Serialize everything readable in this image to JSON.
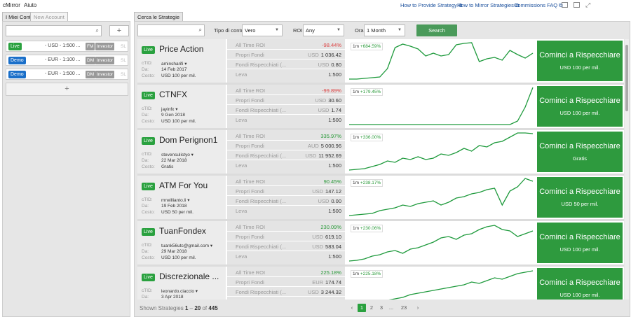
{
  "menu": {
    "app": "cMirror",
    "help": "Aiuto"
  },
  "toplinks": [
    {
      "label": "How to Provide Strategy"
    },
    {
      "label": "How to Mirror Strategies"
    },
    {
      "label": "Commissions FAQ"
    }
  ],
  "left": {
    "tabs": [
      "I Miei Conti",
      "New Account"
    ],
    "plus": "+",
    "accounts": [
      {
        "type": "Live",
        "text": "- USD - 1:500 ...",
        "chips": [
          "FM",
          "Investor",
          "SL"
        ]
      },
      {
        "type": "Demo",
        "text": "- EUR - 1:100 ...",
        "chips": [
          "DM",
          "Investor",
          "SL"
        ]
      },
      {
        "type": "Demo",
        "text": "- EUR - 1:500 ...",
        "chips": [
          "DM",
          "Investor",
          "SL"
        ]
      }
    ],
    "add_label": "+"
  },
  "right": {
    "tab": "Cerca le Strategie",
    "filters": {
      "account_type_label": "Tipo di conto",
      "account_type": "Vero",
      "roi_label": "ROI",
      "roi": "Any",
      "time_label": "Ora",
      "time": "1 Month",
      "search_button": "Search"
    },
    "stat_labels": [
      "All Time ROI",
      "Propri Fondi",
      "Fondi Rispecchiati (...",
      "Leva"
    ],
    "info_labels": [
      "cTID:",
      "Da:",
      "Costo:"
    ],
    "copy_label": "Cominci a Rispecchiare",
    "period": "1m",
    "strategies": [
      {
        "name": "Price Action",
        "status": "Live",
        "ctid": "aminsharifi",
        "since": "14 Feb 2017",
        "cost": "USD 100 per mil.",
        "roi": "-98.44%",
        "roi_sign": "neg",
        "own_cur": "USD",
        "own": "1 036.42",
        "mir_cur": "USD",
        "mir": "0.80",
        "lev": "1:500",
        "change": "+684.59%",
        "curve": [
          55,
          55,
          54,
          53,
          52,
          40,
          10,
          5,
          8,
          12,
          22,
          18,
          22,
          20,
          6,
          4,
          3,
          30,
          26,
          24,
          28,
          14,
          20,
          25,
          18
        ]
      },
      {
        "name": "CTNFX",
        "status": "Live",
        "ctid": "jayinfx",
        "since": "9 Gen 2018",
        "cost": "USD 100 per mil.",
        "roi": "-99.89%",
        "roi_sign": "neg",
        "own_cur": "USD",
        "own": "30.60",
        "mir_cur": "USD",
        "mir": "1.74",
        "lev": "1:500",
        "change": "+179.45%",
        "curve": [
          55,
          55,
          55,
          55,
          55,
          55,
          55,
          55,
          55,
          55,
          55,
          55,
          55,
          55,
          55,
          55,
          55,
          55,
          55,
          55,
          55,
          55,
          50,
          30,
          2
        ]
      },
      {
        "name": "Dom Perignon1",
        "status": "Live",
        "ctid": "stevensulistyo",
        "since": "22 Mar 2018",
        "cost": "Gratis",
        "roi": "335.97%",
        "roi_sign": "pos",
        "own_cur": "AUD",
        "own": "5 000.96",
        "mir_cur": "USD",
        "mir": "11 952.69",
        "lev": "1:500",
        "change": "+336.00%",
        "curve": [
          55,
          54,
          53,
          50,
          47,
          42,
          44,
          38,
          40,
          36,
          40,
          38,
          32,
          34,
          30,
          24,
          28,
          20,
          22,
          16,
          14,
          8,
          2,
          2,
          3
        ]
      },
      {
        "name": "ATM For You",
        "status": "Live",
        "ctid": "mrwillianto.li",
        "since": "19 Feb 2018",
        "cost": "USD 50 per mil.",
        "roi": "90.45%",
        "roi_sign": "pos",
        "own_cur": "USD",
        "own": "147.12",
        "mir_cur": "USD",
        "mir": "0.00",
        "lev": "1:500",
        "change": "+238.17%",
        "curve": [
          55,
          54,
          53,
          52,
          48,
          46,
          44,
          40,
          42,
          38,
          36,
          34,
          40,
          36,
          30,
          28,
          24,
          22,
          18,
          16,
          40,
          20,
          14,
          2,
          6
        ]
      },
      {
        "name": "TuanFondex",
        "status": "Live",
        "ctid": "tuank56utc@gmail.com",
        "since": "29 Mar 2018",
        "cost": "USD 100 per mil.",
        "roi": "230.09%",
        "roi_sign": "pos",
        "own_cur": "USD",
        "own": "619.10",
        "mir_cur": "USD",
        "mir": "583.04",
        "lev": "1:500",
        "change": "+230.06%",
        "curve": [
          55,
          54,
          52,
          48,
          46,
          42,
          40,
          44,
          38,
          36,
          32,
          28,
          22,
          20,
          24,
          18,
          16,
          10,
          6,
          4,
          10,
          12,
          20,
          16,
          12
        ]
      },
      {
        "name": "Discrezionale ...",
        "status": "Live",
        "ctid": "leonardo.ciaccio",
        "since": "3 Apr 2018",
        "cost": "USD 100 per mil.",
        "roi": "225.18%",
        "roi_sign": "pos",
        "own_cur": "EUR",
        "own": "174.74",
        "mir_cur": "USD",
        "mir": "3 244.32",
        "lev": "1:500",
        "change": "+225.18%",
        "curve": [
          55,
          54,
          52,
          50,
          48,
          46,
          44,
          42,
          38,
          36,
          34,
          32,
          30,
          28,
          26,
          24,
          20,
          22,
          18,
          14,
          16,
          12,
          8,
          6,
          4
        ]
      }
    ],
    "footer": {
      "shown": "Shown Strategies",
      "from": "1",
      "dash": "–",
      "to": "20",
      "of": "of",
      "total": "445",
      "pages": [
        "1",
        "2",
        "3",
        "...",
        "23"
      ],
      "prev": "‹",
      "next": "›"
    }
  }
}
